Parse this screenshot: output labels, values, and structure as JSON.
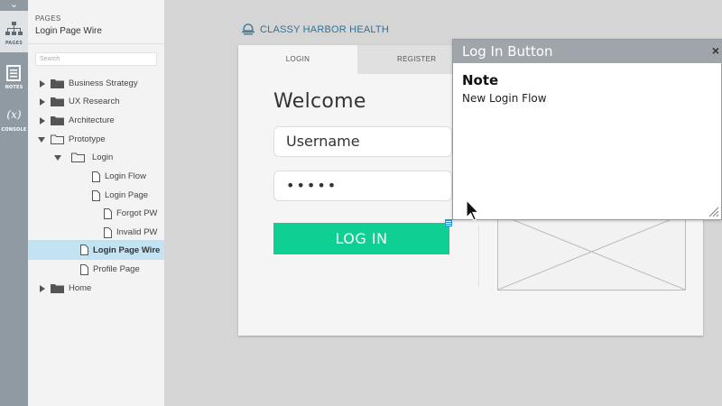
{
  "rail": {
    "pages_label": "PAGES",
    "notes_label": "NOTES",
    "console_glyph": "(x)",
    "console_label": "CONSOLE"
  },
  "panel": {
    "header_label": "PAGES",
    "title": "Login Page Wire",
    "search_placeholder": "Search",
    "tree": [
      {
        "label": "Business Strategy",
        "type": "folder",
        "expanded": false
      },
      {
        "label": "UX Research",
        "type": "folder",
        "expanded": false
      },
      {
        "label": "Architecture",
        "type": "folder",
        "expanded": false
      },
      {
        "label": "Prototype",
        "type": "folder",
        "expanded": true
      },
      {
        "label": "Login",
        "type": "folder",
        "expanded": true
      },
      {
        "label": "Login Flow",
        "type": "page"
      },
      {
        "label": "Login Page",
        "type": "page"
      },
      {
        "label": "Forgot PW",
        "type": "page"
      },
      {
        "label": "Invalid PW",
        "type": "page"
      },
      {
        "label": "Login Page Wire",
        "type": "page",
        "selected": true
      },
      {
        "label": "Profile Page",
        "type": "page"
      },
      {
        "label": "Home",
        "type": "folder",
        "expanded": false
      }
    ]
  },
  "canvas": {
    "brand": "CLASSY HARBOR HEALTH",
    "tabs": {
      "login": "LOGIN",
      "register": "REGISTER"
    },
    "welcome": "Welcome",
    "username_value": "Username",
    "password_value": "•••••",
    "login_button": "LOG IN"
  },
  "note_popup": {
    "title": "Log In Button",
    "close": "×",
    "heading": "Note",
    "body": "New Login Flow"
  },
  "colors": {
    "rail": "#8f9aa3",
    "accent_green": "#0fcf92",
    "selected_row": "#c3e2f2",
    "brand_blue": "#2d7496",
    "note_header": "#9fa5aa"
  }
}
